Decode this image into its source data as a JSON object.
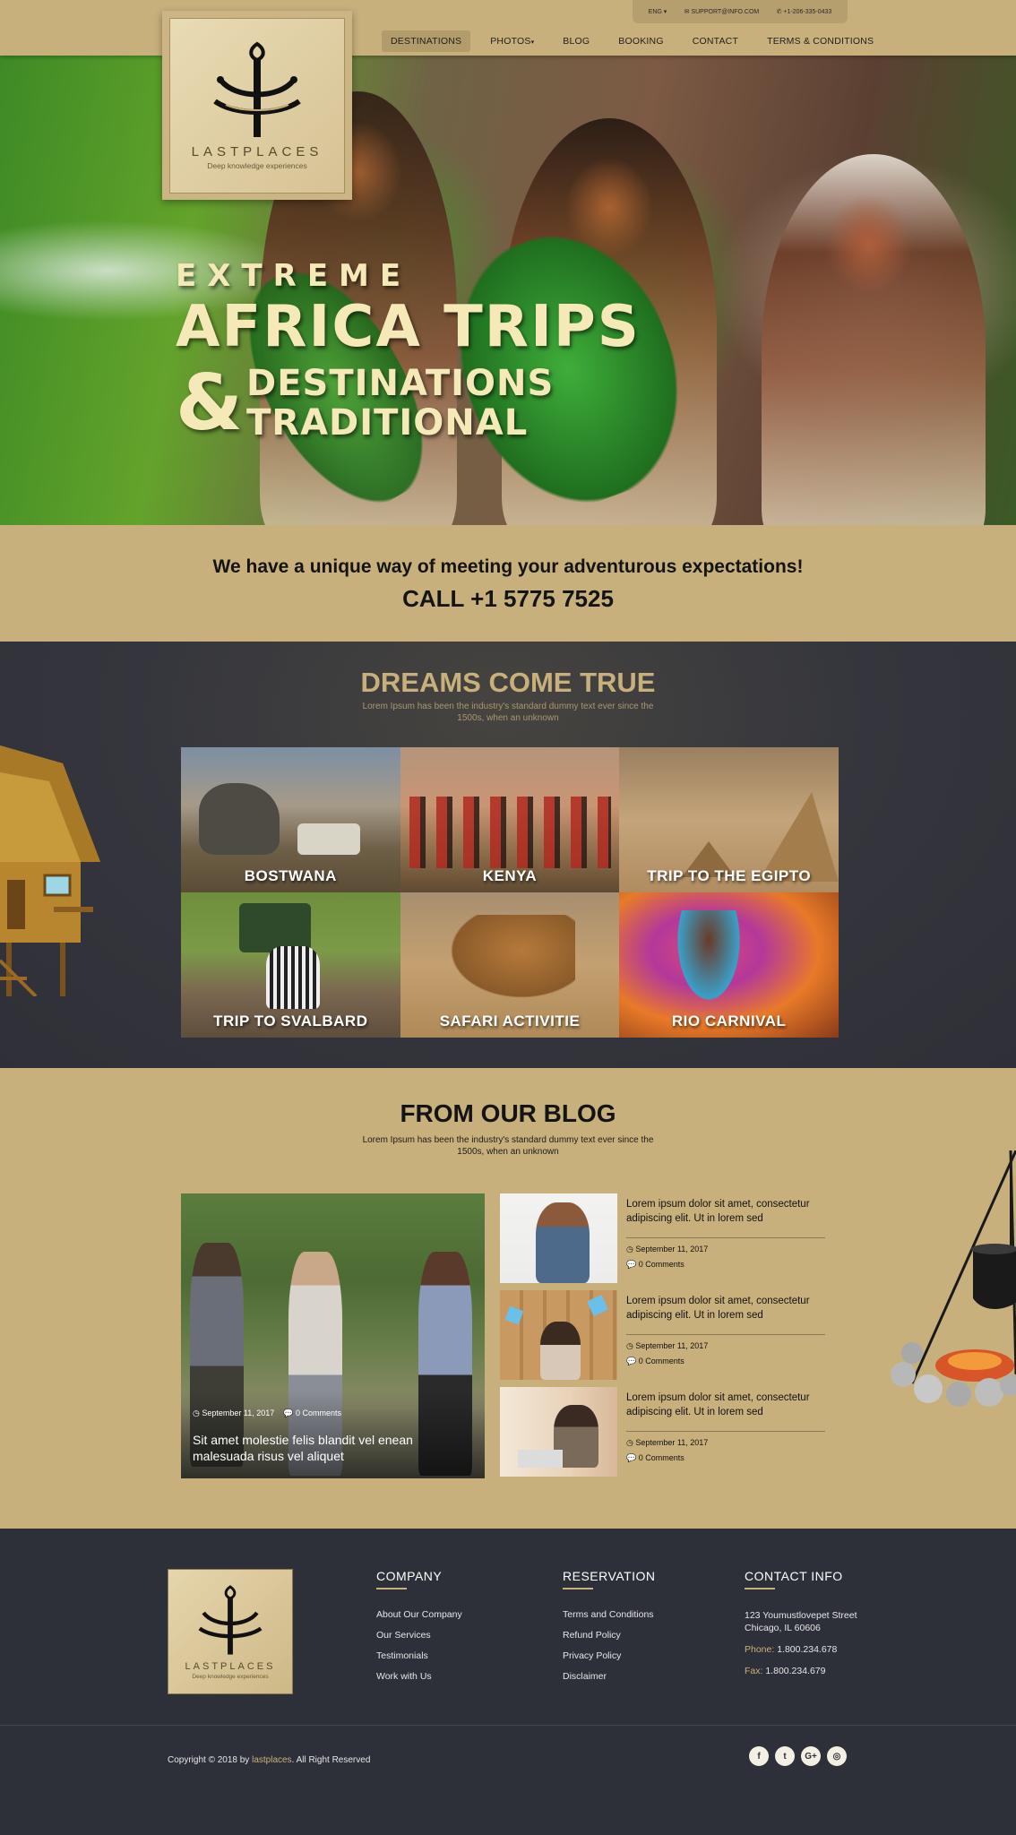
{
  "topbar": {
    "language": "ENG",
    "email": "SUPPORT@INFO.COM",
    "phone": "+1-206-335-0433"
  },
  "nav": {
    "items": [
      {
        "label": "DESTINATIONS",
        "active": true
      },
      {
        "label": "PHOTOS",
        "dropdown": true
      },
      {
        "label": "BLOG"
      },
      {
        "label": "BOOKING"
      },
      {
        "label": "CONTACT"
      },
      {
        "label": "TERMS & CONDITIONS"
      }
    ]
  },
  "logo": {
    "word": "LASTPLACES",
    "tagline": "Deep knowledge experiences"
  },
  "hero": {
    "line1": "EXTREME",
    "line2": "AFRICA TRIPS",
    "amp": "&",
    "line3": "DESTINATIONS",
    "line4": "TRADITIONAL"
  },
  "callband": {
    "tagline": "We have a unique way of meeting your adventurous expectations!",
    "phone": "CALL +1 5775 7525"
  },
  "dreams": {
    "title": "DREAMS COME TRUE",
    "subtitle": "Lorem Ipsum has been the industry's standard dummy text ever since the 1500s, when an unknown",
    "tiles": [
      {
        "label": "BOSTWANA"
      },
      {
        "label": "KENYA"
      },
      {
        "label": "TRIP TO THE EGIPTO"
      },
      {
        "label": "TRIP TO SVALBARD"
      },
      {
        "label": "SAFARI ACTIVITIE"
      },
      {
        "label": "RIO CARNIVAL"
      }
    ]
  },
  "blog": {
    "title": "FROM OUR BLOG",
    "subtitle": "Lorem Ipsum has been the industry's standard dummy text ever since the 1500s, when an unknown",
    "feature": {
      "date": "September 11, 2017",
      "comments": "0 Comments",
      "title": "Sit amet molestie felis blandit vel enean malesuada risus vel aliquet"
    },
    "posts": [
      {
        "title": "Lorem ipsum dolor sit amet, consectetur adipiscing elit. Ut in lorem sed",
        "date": "September 11, 2017",
        "comments": "0 Comments"
      },
      {
        "title": "Lorem ipsum dolor sit amet, consectetur adipiscing elit. Ut in lorem sed",
        "date": "September 11, 2017",
        "comments": "0 Comments"
      },
      {
        "title": "Lorem ipsum dolor sit amet, consectetur adipiscing elit. Ut in lorem sed",
        "date": "September 11, 2017",
        "comments": "0 Comments"
      }
    ]
  },
  "footer": {
    "company": {
      "heading": "COMPANY",
      "links": [
        "About Our Company",
        "Our Services",
        "Testimonials",
        "Work with Us"
      ]
    },
    "reservation": {
      "heading": "RESERVATION",
      "links": [
        "Terms and Conditions",
        "Refund Policy",
        "Privacy Policy",
        "Disclaimer"
      ]
    },
    "contact": {
      "heading": "CONTACT INFO",
      "address_line1": "123 Youmustlovepet Street",
      "address_line2": "Chicago, IL 60606",
      "phone_label": "Phone:",
      "phone": "1.800.234.678",
      "fax_label": "Fax:",
      "fax": "1.800.234.679"
    },
    "copyright_prefix": "Copyright © 2018 by",
    "copyright_brand": "lastplaces",
    "copyright_suffix": ". All Right Reserved",
    "socials": [
      {
        "icon": "facebook-icon",
        "glyph": "f"
      },
      {
        "icon": "twitter-icon",
        "glyph": "t"
      },
      {
        "icon": "google-plus-icon",
        "glyph": "G+"
      },
      {
        "icon": "instagram-icon",
        "glyph": "◎"
      }
    ]
  },
  "colors": {
    "gold": "#c8b07c",
    "dark": "#2e3039",
    "hero_text": "#f5e9b8"
  }
}
